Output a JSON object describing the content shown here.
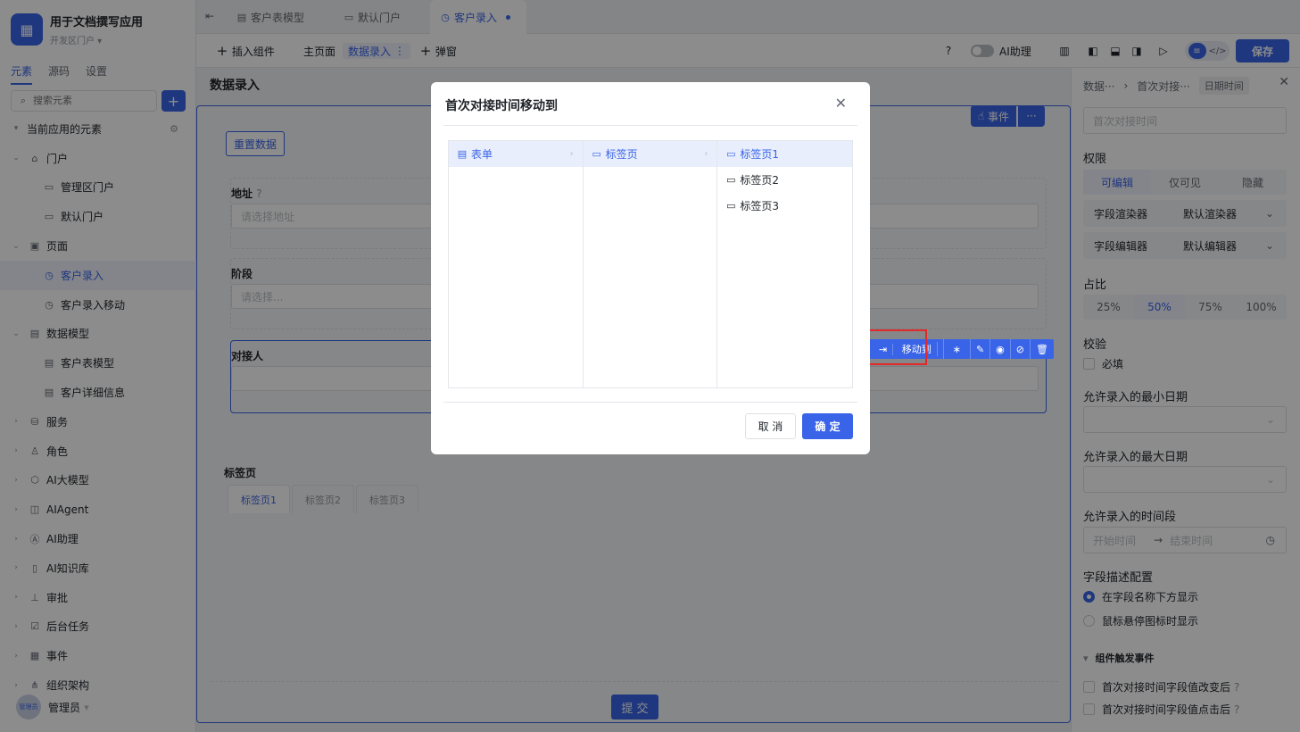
{
  "app": {
    "title": "用于文档撰写应用",
    "subtitle": "开发区门户 ▾"
  },
  "sidebar": {
    "tabs": [
      "元素",
      "源码",
      "设置"
    ],
    "search_placeholder": "搜索元素",
    "add_label": "+",
    "tree": [
      {
        "label": "当前应用的元素",
        "icon": "none",
        "level": 0,
        "arrow": "▾"
      },
      {
        "label": "门户",
        "icon": "home-icon",
        "level": 1,
        "arrow": "⌄"
      },
      {
        "label": "管理区门户",
        "icon": "monitor-icon",
        "level": 2,
        "arrow": ""
      },
      {
        "label": "默认门户",
        "icon": "monitor-icon",
        "level": 2,
        "arrow": ""
      },
      {
        "label": "页面",
        "icon": "page-icon",
        "level": 1,
        "arrow": "⌄"
      },
      {
        "label": "客户录入",
        "icon": "form-page-icon",
        "level": 2,
        "arrow": "",
        "active": true
      },
      {
        "label": "客户录入移动",
        "icon": "form-page-icon",
        "level": 2,
        "arrow": ""
      },
      {
        "label": "数据模型",
        "icon": "table-icon",
        "level": 1,
        "arrow": "⌄"
      },
      {
        "label": "客户表模型",
        "icon": "table-icon",
        "level": 2,
        "arrow": ""
      },
      {
        "label": "客户详细信息",
        "icon": "table-icon",
        "level": 2,
        "arrow": ""
      },
      {
        "label": "服务",
        "icon": "service-icon",
        "level": 1,
        "arrow": "›"
      },
      {
        "label": "角色",
        "icon": "role-icon",
        "level": 1,
        "arrow": "›"
      },
      {
        "label": "AI大模型",
        "icon": "ai-model-icon",
        "level": 1,
        "arrow": "›"
      },
      {
        "label": "AIAgent",
        "icon": "robot-icon",
        "level": 1,
        "arrow": "›"
      },
      {
        "label": "AI助理",
        "icon": "ai-icon",
        "level": 1,
        "arrow": "›"
      },
      {
        "label": "AI知识库",
        "icon": "book-icon",
        "level": 1,
        "arrow": "›"
      },
      {
        "label": "审批",
        "icon": "stamp-icon",
        "level": 1,
        "arrow": "›"
      },
      {
        "label": "后台任务",
        "icon": "task-icon",
        "level": 1,
        "arrow": "›"
      },
      {
        "label": "事件",
        "icon": "event-icon",
        "level": 1,
        "arrow": "›"
      },
      {
        "label": "组织架构",
        "icon": "org-icon",
        "level": 1,
        "arrow": "›"
      }
    ],
    "user": {
      "name": "管理员",
      "avatar_text": "管理员"
    }
  },
  "doc_tabs": [
    "客户表模型",
    "默认门户",
    "客户录入"
  ],
  "toolbar": {
    "insert": "插入组件",
    "home": "主页面",
    "data_entry": "数据录入",
    "popup": "弹窗",
    "ai_assistant": "AI助理",
    "save": "保存"
  },
  "canvas": {
    "page_title": "数据录入",
    "event_button": "事件",
    "reset_button": "重置数据",
    "fields": [
      {
        "label": "地址",
        "placeholder": "请选择地址"
      },
      {
        "label": "阶段",
        "placeholder": "请选择..."
      },
      {
        "label": "对接人",
        "placeholder": ""
      }
    ],
    "move_to": "移动到",
    "tabs_label": "标签页",
    "tabs": [
      "标签页1",
      "标签页2",
      "标签页3"
    ],
    "submit": "提 交"
  },
  "right_panel": {
    "crumb_1": "数据···",
    "crumb_2": "首次对接···",
    "crumb_badge": "日期时间",
    "title_placeholder": "首次对接时间",
    "perm_title": "权限",
    "perm_options": [
      "可编辑",
      "仅可见",
      "隐藏"
    ],
    "renderer_label": "字段渲染器",
    "renderer_value": "默认渲染器",
    "editor_label": "字段编辑器",
    "editor_value": "默认编辑器",
    "ratio_title": "占比",
    "ratio_options": [
      "25%",
      "50%",
      "75%",
      "100%"
    ],
    "validate_title": "校验",
    "required": "必填",
    "min_date_title": "允许录入的最小日期",
    "max_date_title": "允许录入的最大日期",
    "time_range_title": "允许录入的时间段",
    "start_time": "开始时间",
    "end_time": "结束时间",
    "desc_title": "字段描述配置",
    "desc_opt1": "在字段名称下方显示",
    "desc_opt2": "鼠标悬停图标时显示",
    "events_title": "组件触发事件",
    "event1": "首次对接时间字段值改变后",
    "event2": "首次对接时间字段值点击后"
  },
  "modal": {
    "title": "首次对接时间移动到",
    "col1": [
      "表单"
    ],
    "col2": [
      "标签页"
    ],
    "col3": [
      "标签页1",
      "标签页2",
      "标签页3"
    ],
    "cancel": "取 消",
    "ok": "确 定"
  },
  "colors": {
    "accent": "#3a64e8",
    "highlight": "#e22a2a"
  }
}
